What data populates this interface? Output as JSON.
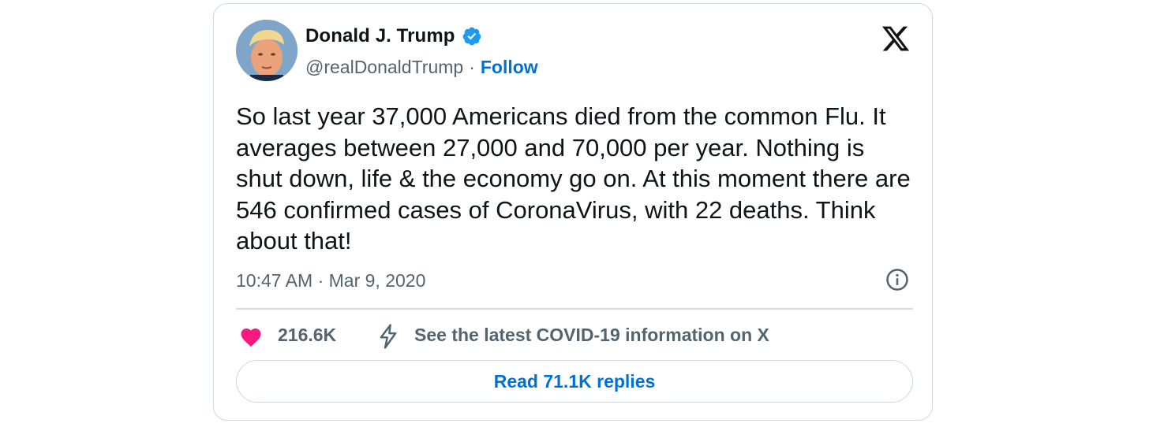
{
  "author": {
    "display_name": "Donald J. Trump",
    "handle": "@realDonaldTrump",
    "separator": "·",
    "follow_label": "Follow",
    "verified": true
  },
  "tweet": {
    "text": "So last year 37,000 Americans died from the common Flu. It averages between 27,000 and 70,000 per year. Nothing is shut down, life & the economy go on. At this moment there are 546 confirmed cases of CoronaVirus, with 22 deaths. Think about that!",
    "timestamp": "10:47 AM · Mar 9, 2020"
  },
  "engagement": {
    "like_count": "216.6K",
    "covid_info_label": "See the latest COVID-19 information on X",
    "read_replies_label": "Read 71.1K replies"
  },
  "icons": {
    "brand": "x-logo-icon",
    "verified": "verified-badge-icon",
    "info": "info-icon",
    "like": "heart-icon",
    "covid": "lightning-bolt-icon"
  },
  "colors": {
    "text_primary": "#0f1419",
    "text_secondary": "#536471",
    "link_blue": "#006fd6",
    "verified_blue": "#1d9bf0",
    "like_pink": "#f91880",
    "border": "#cfd9de"
  }
}
